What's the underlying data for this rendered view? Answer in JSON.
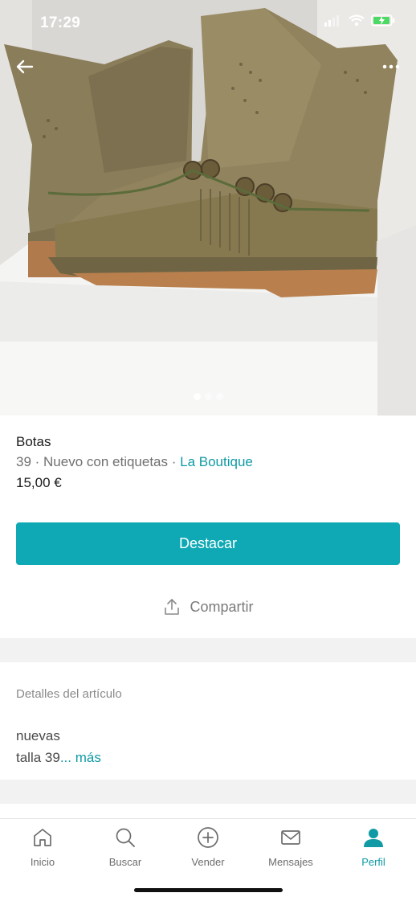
{
  "status_bar": {
    "time": "17:29"
  },
  "photo": {
    "alt_icon": "boots-photo",
    "carousel": {
      "pages": 3,
      "current": 1
    }
  },
  "item": {
    "title": "Botas",
    "meta_prefix": "39 · Nuevo con etiquetas · ",
    "brand": "La Boutique",
    "price": "15,00 €"
  },
  "actions": {
    "highlight_label": "Destacar",
    "share_label": "Compartir"
  },
  "details": {
    "title": "Detalles del artículo",
    "line1": "nuevas",
    "line2": "talla 39",
    "more_label": "... más"
  },
  "tabbar": {
    "items": [
      {
        "label": "Inicio",
        "icon": "home-icon"
      },
      {
        "label": "Buscar",
        "icon": "search-icon"
      },
      {
        "label": "Vender",
        "icon": "plus-circle-icon"
      },
      {
        "label": "Mensajes",
        "icon": "mail-icon"
      },
      {
        "label": "Perfil",
        "icon": "profile-icon"
      }
    ],
    "active": "Perfil"
  },
  "colors": {
    "accent": "#0ea9b4",
    "link": "#109aa5"
  }
}
